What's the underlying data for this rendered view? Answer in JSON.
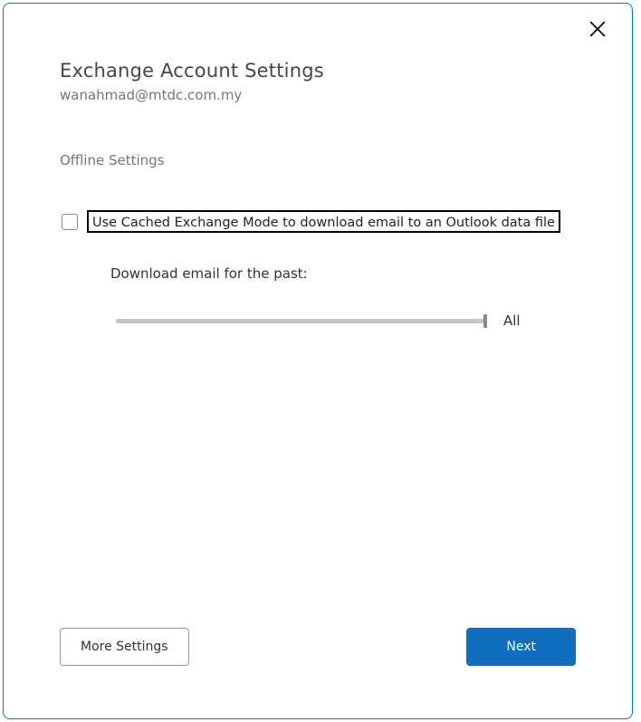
{
  "header": {
    "title": "Exchange Account Settings",
    "email": "wanahmad@mtdc.com.my"
  },
  "offline": {
    "section_title": "Offline Settings",
    "cached_mode_label": "Use Cached Exchange Mode to download email to an Outlook data file",
    "cached_mode_checked": false,
    "download_label": "Download email for the past:",
    "slider_value_label": "All"
  },
  "buttons": {
    "more_settings": "More Settings",
    "next": "Next"
  },
  "colors": {
    "accent": "#0078d4",
    "primary_button": "#106ebe"
  }
}
